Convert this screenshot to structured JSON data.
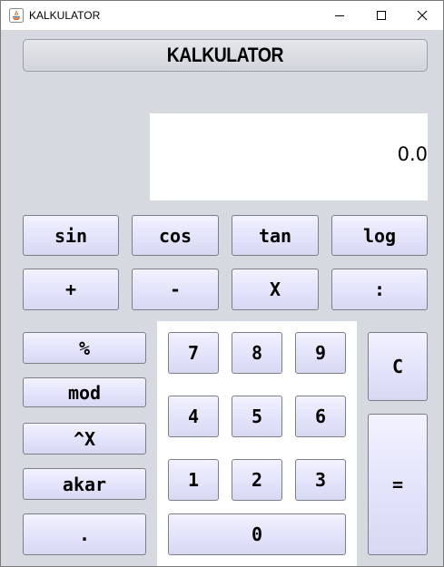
{
  "window": {
    "title": "KALKULATOR",
    "controls": {
      "minimize": "minimize-icon",
      "maximize": "maximize-icon",
      "close": "close-icon"
    }
  },
  "header": {
    "title": "KALKULATOR"
  },
  "display": {
    "value": "0.0"
  },
  "buttons": {
    "sin": "sin",
    "cos": "cos",
    "tan": "tan",
    "log": "log",
    "plus": "+",
    "minus": "-",
    "times": "X",
    "divide": ":",
    "percent": "%",
    "mod": "mod",
    "power": "^X",
    "root": "akar",
    "dot": ".",
    "seven": "7",
    "eight": "8",
    "nine": "9",
    "four": "4",
    "five": "5",
    "six": "6",
    "one": "1",
    "two": "2",
    "three": "3",
    "zero": "0",
    "clear": "C",
    "equals": "="
  },
  "colors": {
    "window_bg": "#d6d9df",
    "button_bg": "#e3e3fb",
    "button_border": "#7b7f88",
    "display_bg": "#ffffff"
  }
}
